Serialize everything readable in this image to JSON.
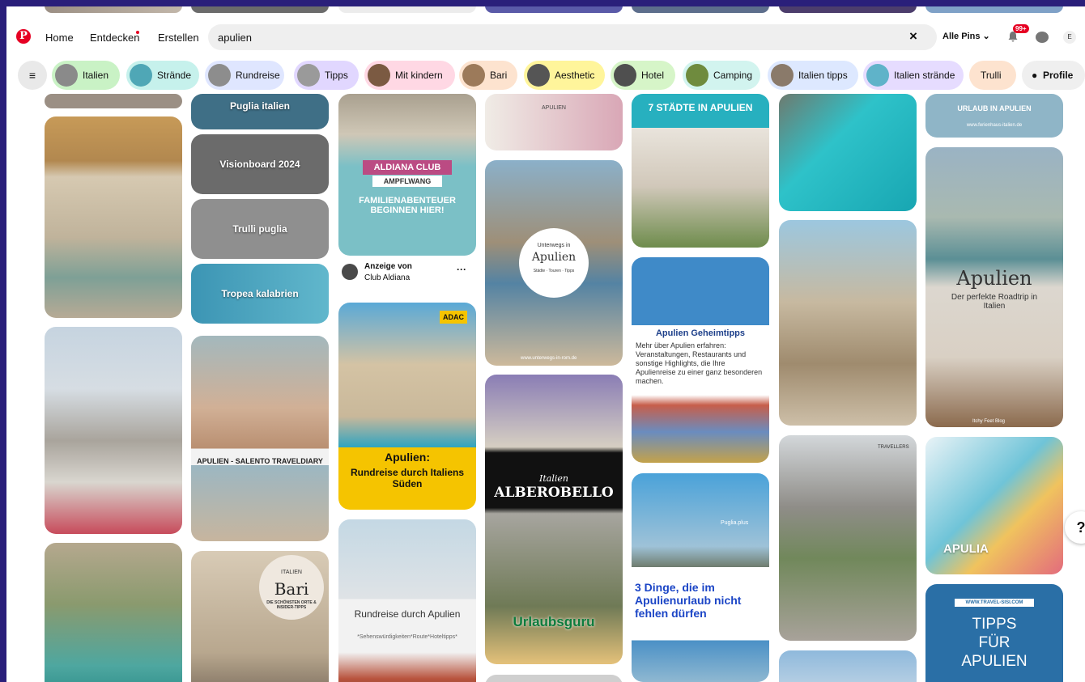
{
  "header": {
    "nav": {
      "home": "Home",
      "explore": "Entdecken",
      "create": "Erstellen"
    },
    "search_value": "apulien",
    "clear_icon": "×",
    "scope": "Alle Pins ⌄",
    "badge": "99+",
    "avatar": "E"
  },
  "chips": [
    {
      "label": "Italien",
      "color": "#c9f2c5"
    },
    {
      "label": "Strände",
      "color": "#c6f1ec"
    },
    {
      "label": "Rundreise",
      "color": "#dfe6ff"
    },
    {
      "label": "Tipps",
      "color": "#e1d7ff"
    },
    {
      "label": "Mit kindern",
      "color": "#ffd8e4"
    },
    {
      "label": "Bari",
      "color": "#fde3cf"
    },
    {
      "label": "Aesthetic",
      "color": "#fff59b"
    },
    {
      "label": "Hotel",
      "color": "#d6f5c8"
    },
    {
      "label": "Camping",
      "color": "#d2f4ef"
    },
    {
      "label": "Italien tipps",
      "color": "#dde8ff"
    },
    {
      "label": "Italien strände",
      "color": "#e6dcff"
    },
    {
      "label": "Trulli",
      "color": "#fde3cf"
    },
    {
      "label": "Profile",
      "color": "#efefef"
    }
  ],
  "pins": {
    "puglia": "Puglia italien",
    "visionboard": "Visionboard 2024",
    "trulli": "Trulli puglia",
    "tropea": "Tropea kalabrien",
    "aldiana_club": "ALDIANA CLUB",
    "aldiana_sub": "AMPFLWANG",
    "aldiana_text": "FAMILIENABENTEUER BEGINNEN HIER!",
    "ad_label": "Anzeige von",
    "ad_name": "Club Aldiana",
    "ad_more": "···",
    "adac": "ADAC",
    "apulien_rund": "Apulien:",
    "apulien_rund2": "Rundreise durch Italiens Süden",
    "rundreise": "Rundreise durch Apulien",
    "rundreise_sub": "*Sehenswürdigkeiten*Route*Hoteltipps*",
    "salento": "APULIEN - SALENTO TRAVELDIARY",
    "bari_small": "ITALIEN",
    "bari": "Bari",
    "bari_sub": "DIE SCHÖNSTEN ORTE & INSIDER-TIPPS",
    "apulien_small": "APULIEN",
    "unterwegs": "Unterwegs in",
    "unterwegs_title": "Apulien",
    "unterwegs_sub": "Städte · Touren · Tipps",
    "unterwegs_url": "www.unterwegs-in-rom.de",
    "italien_script": "Italien",
    "alberobello": "ALBEROBELLO",
    "urlaubsguru": "Urlaubsguru",
    "staedte": "7 STÄDTE IN APULIEN",
    "geheim_title": "Apulien Geheimtipps",
    "geheim_text": "Mehr über Apulien erfahren: Veranstaltungen, Restaurants und sonstige Highlights, die Ihre Apulienreise zu einer ganz besonderen machen.",
    "puglia_plus": "Puglia.plus",
    "dinge": "3 Dinge, die im Apulienurlaub nicht fehlen dürfen",
    "urlaub": "URLAUB IN APULIEN",
    "urlaub_url": "www.ferienhaus-italien.de",
    "roadtrip_title": "Apulien",
    "roadtrip_sub": "Der perfekte Roadtrip in Italien",
    "itchy": "Itchy Feet Blog",
    "travellers": "TRAVELLERS",
    "apulia": "APULIA",
    "tipps_url": "WWW.TRAVEL-SISI.COM",
    "tipps_title": "TIPPS FÜR APULIEN"
  },
  "help": "?"
}
